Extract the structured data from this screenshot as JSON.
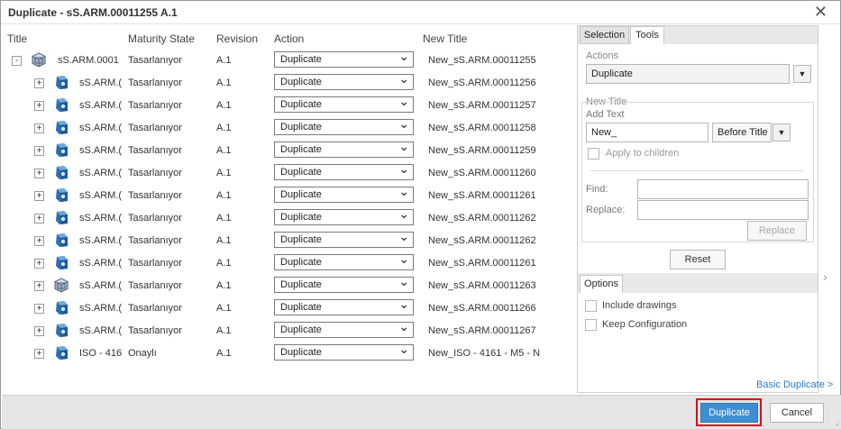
{
  "window": {
    "title": "Duplicate - sS.ARM.00011255 A.1",
    "close_glyph": "✕"
  },
  "table": {
    "columns": {
      "title": "Title",
      "maturity": "Maturity State",
      "revision": "Revision",
      "action": "Action",
      "new_title": "New Title"
    },
    "rows": [
      {
        "expander": "-",
        "title": "sS.ARM.0001",
        "maturity": "Tasarlanıyor",
        "revision": "A.1",
        "action": "Duplicate",
        "new_title": "New_sS.ARM.00011255",
        "icon": "assembly-icon"
      },
      {
        "expander": "+",
        "title": "sS.ARM.(",
        "maturity": "Tasarlanıyor",
        "revision": "A.1",
        "action": "Duplicate",
        "new_title": "New_sS.ARM.00011256",
        "icon": "part-icon"
      },
      {
        "expander": "+",
        "title": "sS.ARM.(",
        "maturity": "Tasarlanıyor",
        "revision": "A.1",
        "action": "Duplicate",
        "new_title": "New_sS.ARM.00011257",
        "icon": "part-icon"
      },
      {
        "expander": "+",
        "title": "sS.ARM.(",
        "maturity": "Tasarlanıyor",
        "revision": "A.1",
        "action": "Duplicate",
        "new_title": "New_sS.ARM.00011258",
        "icon": "part-icon"
      },
      {
        "expander": "+",
        "title": "sS.ARM.(",
        "maturity": "Tasarlanıyor",
        "revision": "A.1",
        "action": "Duplicate",
        "new_title": "New_sS.ARM.00011259",
        "icon": "part-icon"
      },
      {
        "expander": "+",
        "title": "sS.ARM.(",
        "maturity": "Tasarlanıyor",
        "revision": "A.1",
        "action": "Duplicate",
        "new_title": "New_sS.ARM.00011260",
        "icon": "part-icon"
      },
      {
        "expander": "+",
        "title": "sS.ARM.(",
        "maturity": "Tasarlanıyor",
        "revision": "A.1",
        "action": "Duplicate",
        "new_title": "New_sS.ARM.00011261",
        "icon": "part-icon"
      },
      {
        "expander": "+",
        "title": "sS.ARM.(",
        "maturity": "Tasarlanıyor",
        "revision": "A.1",
        "action": "Duplicate",
        "new_title": "New_sS.ARM.00011262",
        "icon": "part-icon"
      },
      {
        "expander": "+",
        "title": "sS.ARM.(",
        "maturity": "Tasarlanıyor",
        "revision": "A.1",
        "action": "Duplicate",
        "new_title": "New_sS.ARM.00011262",
        "icon": "part-icon"
      },
      {
        "expander": "+",
        "title": "sS.ARM.(",
        "maturity": "Tasarlanıyor",
        "revision": "A.1",
        "action": "Duplicate",
        "new_title": "New_sS.ARM.00011261",
        "icon": "part-icon"
      },
      {
        "expander": "+",
        "title": "sS.ARM.(",
        "maturity": "Tasarlanıyor",
        "revision": "A.1",
        "action": "Duplicate",
        "new_title": "New_sS.ARM.00011263",
        "icon": "assembly-icon"
      },
      {
        "expander": "+",
        "title": "sS.ARM.(",
        "maturity": "Tasarlanıyor",
        "revision": "A.1",
        "action": "Duplicate",
        "new_title": "New_sS.ARM.00011266",
        "icon": "part-icon"
      },
      {
        "expander": "+",
        "title": "sS.ARM.(",
        "maturity": "Tasarlanıyor",
        "revision": "A.1",
        "action": "Duplicate",
        "new_title": "New_sS.ARM.00011267",
        "icon": "part-icon"
      },
      {
        "expander": "+",
        "title": "ISO - 416",
        "maturity": "Onaylı",
        "revision": "A.1",
        "action": "Duplicate",
        "new_title": "New_ISO - 4161 - M5 - N",
        "icon": "part-icon"
      }
    ]
  },
  "tabs": {
    "selection": "Selection",
    "tools": "Tools"
  },
  "tools": {
    "actions_group": "Actions",
    "actions_value": "Duplicate",
    "new_title_group": "New Title",
    "add_text_label": "Add Text",
    "add_text_value": "New_",
    "position_value": "Before Title",
    "apply_to_children": "Apply to children",
    "find_label": "Find:",
    "find_value": "",
    "replace_label": "Replace:",
    "replace_value": "",
    "replace_button": "Replace",
    "reset_button": "Reset"
  },
  "options": {
    "tab": "Options",
    "include_drawings": "Include drawings",
    "keep_configuration": "Keep Configuration"
  },
  "links": {
    "basic_duplicate": "Basic Duplicate >"
  },
  "footer": {
    "duplicate_button": "Duplicate",
    "cancel_button": "Cancel"
  },
  "colors": {
    "primary": "#3e8ed0",
    "highlight": "#e0001a",
    "link": "#2a7bc4",
    "icon_blue": "#2a6fb5"
  }
}
